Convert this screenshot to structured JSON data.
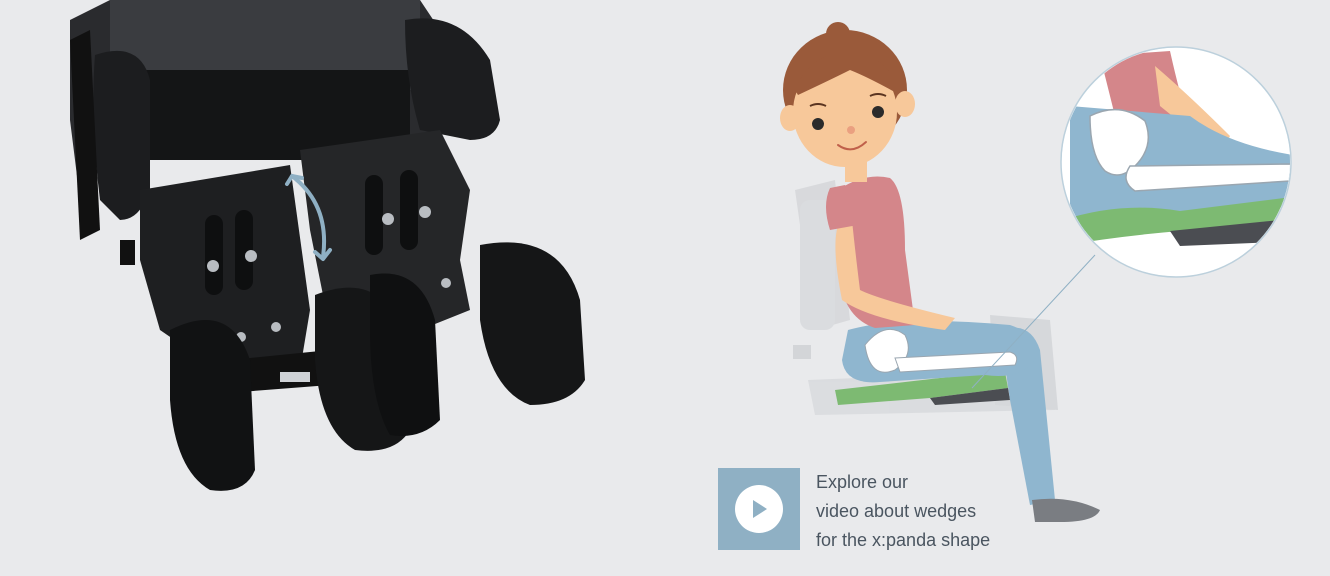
{
  "video_cta": {
    "lines": [
      "Explore our",
      "video about wedges",
      "for the x:panda shape"
    ]
  },
  "icons": {
    "play": "play-icon",
    "adjust": "double-arrow-icon"
  },
  "colors": {
    "background": "#e9eaec",
    "accent_blue": "#8fb0c4",
    "cta_text": "#4a5560",
    "wedge_green": "#7dba72",
    "shirt": "#d4868a",
    "jeans": "#8fb6cf"
  }
}
